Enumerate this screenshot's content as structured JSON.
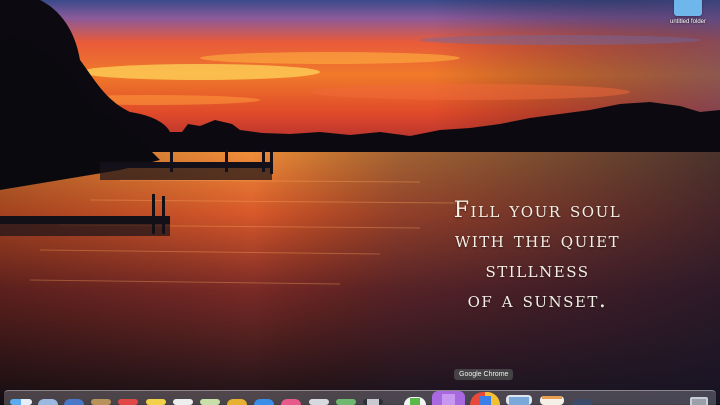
{
  "desktop": {
    "quote_lines": [
      "Fill your soul",
      "with the quiet",
      "stillness",
      "of a sunset."
    ],
    "folder_label": "untitled folder"
  },
  "dock": {
    "tooltip": "Google Chrome",
    "items": [
      {
        "name": "finder-icon",
        "color": "#4aa3e8"
      },
      {
        "name": "siri-icon",
        "color": "#8fb8e8"
      },
      {
        "name": "launchpad-icon",
        "color": "#b0b8c8"
      },
      {
        "name": "notes-icon",
        "color": "#c8a070"
      },
      {
        "name": "calendar-icon",
        "color": "#e04848"
      },
      {
        "name": "stickies-icon",
        "color": "#f0d050"
      },
      {
        "name": "reminders-icon",
        "color": "#e8e8e8"
      },
      {
        "name": "photos-icon",
        "color": "#c8e0a8"
      },
      {
        "name": "chrome-icon",
        "color": "#e8b030"
      },
      {
        "name": "app-store-icon",
        "color": "#3a8ee8"
      },
      {
        "name": "itunes-icon",
        "color": "#e85a8a"
      },
      {
        "name": "mail-icon",
        "color": "#d8d8e0"
      },
      {
        "name": "maps-icon",
        "color": "#70b870"
      },
      {
        "name": "messages-icon",
        "color": "#60c060"
      },
      {
        "name": "evernote-icon",
        "color": "#58b848"
      },
      {
        "name": "podcasts-icon",
        "color": "#9a5ad8"
      },
      {
        "name": "google-chrome-icon",
        "color": "#e84a3a"
      },
      {
        "name": "preview-icon",
        "color": "#7aa8d8"
      },
      {
        "name": "textedit-icon",
        "color": "#e8a050"
      },
      {
        "name": "system-preferences-icon",
        "color": "#8a8a90"
      },
      {
        "name": "trash-icon",
        "color": "#c8ccd4"
      }
    ]
  }
}
